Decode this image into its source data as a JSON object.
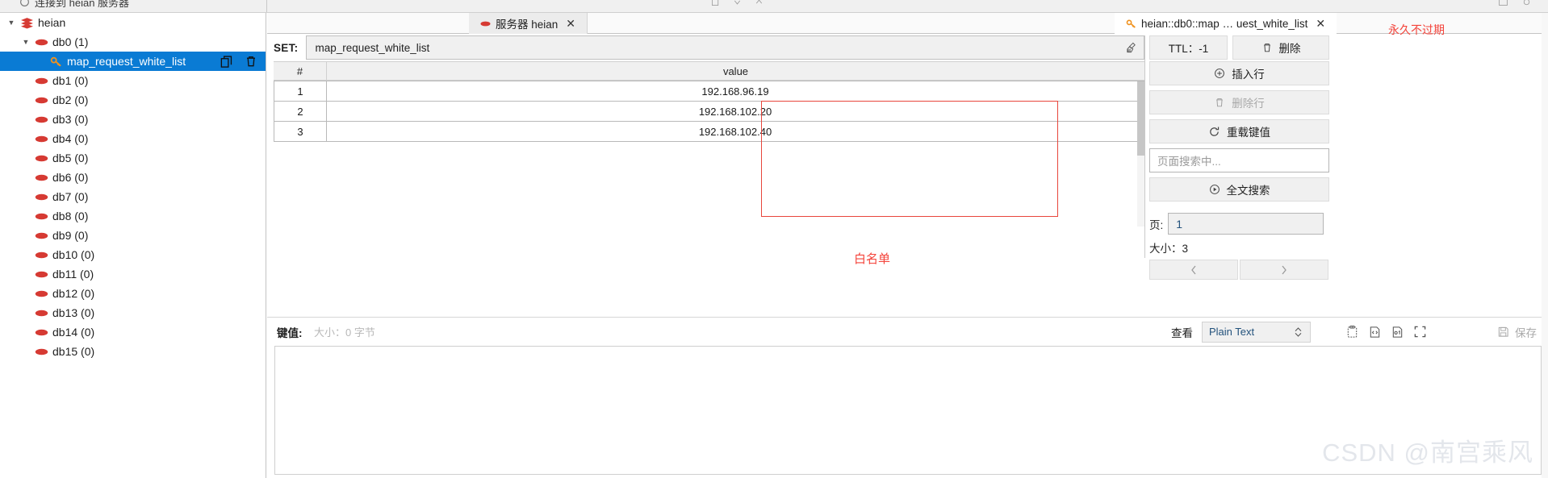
{
  "window": {
    "toolbar_left_hint": "连接到 heian 服务器",
    "toolbar_center_hint": "",
    "toolbar_right_hint": ""
  },
  "sidebar": {
    "items": [
      {
        "label": "heian",
        "icon": "stack-icon",
        "indent": 0,
        "expanded": true,
        "selected": false,
        "count": ""
      },
      {
        "label": "db0",
        "icon": "database-icon",
        "indent": 1,
        "expanded": true,
        "selected": false,
        "count": "(1)"
      },
      {
        "label": "map_request_white_list",
        "icon": "key-icon",
        "indent": 2,
        "expanded": null,
        "selected": true,
        "count": ""
      },
      {
        "label": "db1",
        "icon": "database-icon",
        "indent": 1,
        "expanded": null,
        "selected": false,
        "count": "(0)"
      },
      {
        "label": "db2",
        "icon": "database-icon",
        "indent": 1,
        "expanded": null,
        "selected": false,
        "count": "(0)"
      },
      {
        "label": "db3",
        "icon": "database-icon",
        "indent": 1,
        "expanded": null,
        "selected": false,
        "count": "(0)"
      },
      {
        "label": "db4",
        "icon": "database-icon",
        "indent": 1,
        "expanded": null,
        "selected": false,
        "count": "(0)"
      },
      {
        "label": "db5",
        "icon": "database-icon",
        "indent": 1,
        "expanded": null,
        "selected": false,
        "count": "(0)"
      },
      {
        "label": "db6",
        "icon": "database-icon",
        "indent": 1,
        "expanded": null,
        "selected": false,
        "count": "(0)"
      },
      {
        "label": "db7",
        "icon": "database-icon",
        "indent": 1,
        "expanded": null,
        "selected": false,
        "count": "(0)"
      },
      {
        "label": "db8",
        "icon": "database-icon",
        "indent": 1,
        "expanded": null,
        "selected": false,
        "count": "(0)"
      },
      {
        "label": "db9",
        "icon": "database-icon",
        "indent": 1,
        "expanded": null,
        "selected": false,
        "count": "(0)"
      },
      {
        "label": "db10",
        "icon": "database-icon",
        "indent": 1,
        "expanded": null,
        "selected": false,
        "count": "(0)"
      },
      {
        "label": "db11",
        "icon": "database-icon",
        "indent": 1,
        "expanded": null,
        "selected": false,
        "count": "(0)"
      },
      {
        "label": "db12",
        "icon": "database-icon",
        "indent": 1,
        "expanded": null,
        "selected": false,
        "count": "(0)"
      },
      {
        "label": "db13",
        "icon": "database-icon",
        "indent": 1,
        "expanded": null,
        "selected": false,
        "count": "(0)"
      },
      {
        "label": "db14",
        "icon": "database-icon",
        "indent": 1,
        "expanded": null,
        "selected": false,
        "count": "(0)"
      },
      {
        "label": "db15",
        "icon": "database-icon",
        "indent": 1,
        "expanded": null,
        "selected": false,
        "count": "(0)"
      }
    ]
  },
  "tabs": [
    {
      "label": "服务器 heian",
      "icon": "database-icon",
      "active": false,
      "close": "✕"
    },
    {
      "label": "heian::db0::map … uest_white_list",
      "icon": "key-icon",
      "active": true,
      "close": "✕"
    }
  ],
  "key_header": {
    "set_label": "SET:",
    "key_name": "map_request_white_list",
    "broom_icon": "broom-icon",
    "ttl_label": "TTL：-1",
    "delete_label": "删除",
    "delete_icon": "trash-icon"
  },
  "annotations": {
    "ttl_note": "永久不过期",
    "values_note": "白名单",
    "color": "#f4433a"
  },
  "table": {
    "columns": [
      "#",
      "value"
    ],
    "rows": [
      {
        "num": "1",
        "value": "192.168.96.19"
      },
      {
        "num": "2",
        "value": "192.168.102.20"
      },
      {
        "num": "3",
        "value": "192.168.102.40"
      }
    ]
  },
  "actions": {
    "insert_row": {
      "label": "插入行",
      "icon": "plus-circle-icon",
      "disabled": false
    },
    "delete_row": {
      "label": "删除行",
      "icon": "trash-icon",
      "disabled": true
    },
    "reload_key": {
      "label": "重载键值",
      "icon": "refresh-icon",
      "disabled": false
    },
    "search_placeholder": "页面搜索中...",
    "full_search": {
      "label": "全文搜索",
      "icon": "play-circle-icon",
      "disabled": false
    }
  },
  "pager": {
    "page_label": "页:",
    "page_value": "1",
    "size_label": "大小：3",
    "prev_icon": "chevron-left-icon",
    "next_icon": "chevron-right-icon"
  },
  "editor": {
    "value_label": "键值:",
    "value_size": "大小：0 字节",
    "view_label": "查看",
    "view_mode": "Plain Text",
    "tools": [
      "clipboard-icon",
      "code-icon",
      "binary-icon",
      "fullscreen-icon"
    ],
    "save_label": "保存",
    "save_icon": "save-icon",
    "content": ""
  },
  "watermark": "CSDN @南宫乘风"
}
